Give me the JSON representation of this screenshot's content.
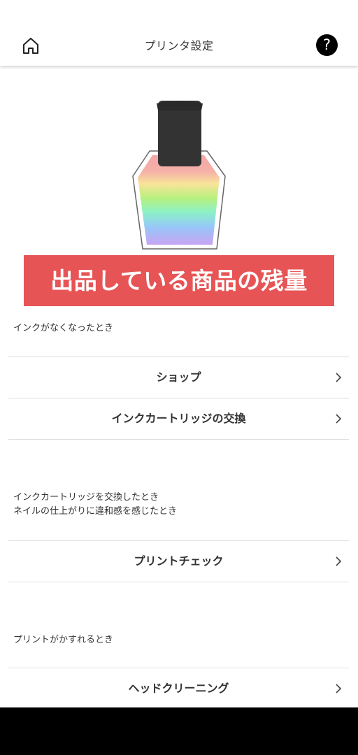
{
  "header": {
    "title": "プリンタ設定",
    "help_label": "?"
  },
  "banner": {
    "text": "出品している商品の残量"
  },
  "sections": {
    "ink_empty": {
      "note": "インクがなくなったとき",
      "items": [
        {
          "label": "ショップ"
        },
        {
          "label": "インクカートリッジの交換"
        }
      ]
    },
    "cartridge_swap": {
      "note_line1": "インクカートリッジを交換したとき",
      "note_line2": "ネイルの仕上がりに違和感を感じたとき",
      "items": [
        {
          "label": "プリントチェック"
        }
      ]
    },
    "faint_print": {
      "note": "プリントがかすれるとき",
      "items": [
        {
          "label": "ヘッドクリーニング"
        }
      ]
    }
  },
  "colors": {
    "banner_bg": "#e75455",
    "text": "#333333",
    "divider": "#dddddd",
    "help_bg": "#000000",
    "bottle_cap": "#333333"
  },
  "icons": {
    "home": "home-icon",
    "help": "help-icon",
    "chevron": "chevron-right-icon",
    "bottle": "ink-bottle-icon"
  }
}
